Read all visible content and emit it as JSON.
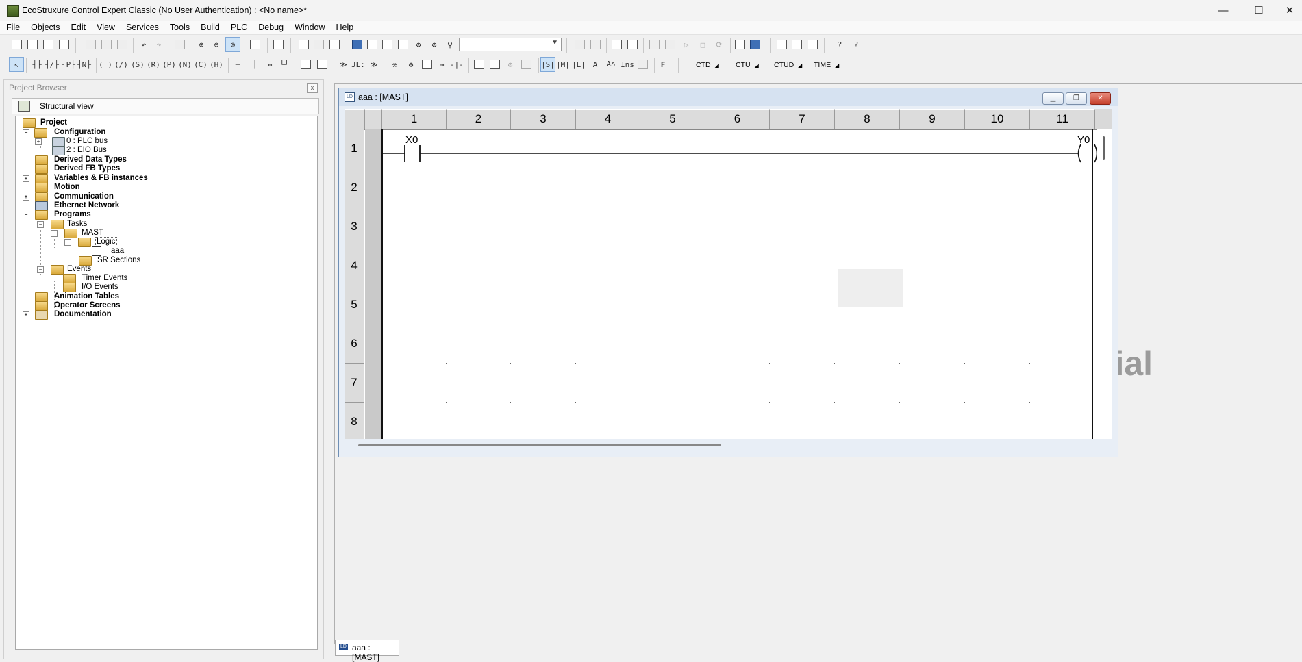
{
  "window": {
    "title": "EcoStruxure Control Expert Classic (No User Authentication) : <No name>*",
    "controls": {
      "minimize": "—",
      "maximize": "☐",
      "close": "✕"
    }
  },
  "menu": [
    "File",
    "Objects",
    "Edit",
    "View",
    "Services",
    "Tools",
    "Build",
    "PLC",
    "Debug",
    "Window",
    "Help"
  ],
  "toolbar2_text": {
    "ins": "Ins",
    "f": "F",
    "function_blocks": [
      "CTD",
      "CTU",
      "CTUD",
      "TIME"
    ]
  },
  "project_browser": {
    "title": "Project Browser",
    "view_label": "Structural view",
    "close": "x",
    "tree": [
      {
        "label": "Project"
      },
      {
        "label": "Configuration"
      },
      {
        "label": "0 : PLC bus"
      },
      {
        "label": "2 : EIO Bus"
      },
      {
        "label": "Derived Data Types"
      },
      {
        "label": "Derived FB Types"
      },
      {
        "label": "Variables & FB instances"
      },
      {
        "label": "Motion"
      },
      {
        "label": "Communication"
      },
      {
        "label": "Ethernet Network"
      },
      {
        "label": "Programs"
      },
      {
        "label": "Tasks"
      },
      {
        "label": "MAST"
      },
      {
        "label": "Logic"
      },
      {
        "label": "aaa"
      },
      {
        "label": "SR Sections"
      },
      {
        "label": "Events"
      },
      {
        "label": "Timer Events"
      },
      {
        "label": "I/O Events"
      },
      {
        "label": "Animation Tables"
      },
      {
        "label": "Operator Screens"
      },
      {
        "label": "Documentation"
      }
    ]
  },
  "ld_editor": {
    "title": "aaa : [MAST]",
    "columns": [
      "1",
      "2",
      "3",
      "4",
      "5",
      "6",
      "7",
      "8",
      "9",
      "10",
      "11"
    ],
    "rows": [
      "1",
      "2",
      "3",
      "4",
      "5",
      "6",
      "7",
      "8"
    ],
    "contact_var": "X0",
    "coil_var": "Y0",
    "watermark": "rial"
  },
  "doc_tab": {
    "label": "aaa : [MAST]"
  }
}
